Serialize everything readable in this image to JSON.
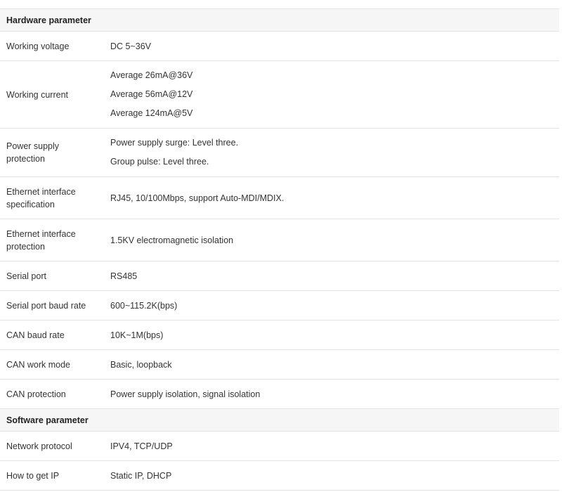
{
  "sections": [
    {
      "title": "Hardware parameter",
      "rows": [
        {
          "name": "Working voltage",
          "values": [
            "DC 5~36V"
          ]
        },
        {
          "name": "Working current",
          "values": [
            "Average 26mA@36V",
            "Average 56mA@12V",
            "Average 124mA@5V"
          ]
        },
        {
          "name": "Power supply protection",
          "values": [
            "Power supply surge: Level three.",
            "Group pulse: Level three."
          ]
        },
        {
          "name": "Ethernet interface specification",
          "values": [
            "RJ45, 10/100Mbps, support Auto-MDI/MDIX."
          ]
        },
        {
          "name": "Ethernet interface protection",
          "values": [
            "1.5KV electromagnetic isolation"
          ]
        },
        {
          "name": "Serial port",
          "values": [
            "RS485"
          ]
        },
        {
          "name": "Serial port baud rate",
          "values": [
            "600~115.2K(bps)"
          ]
        },
        {
          "name": "CAN baud rate",
          "values": [
            "10K~1M(bps)"
          ]
        },
        {
          "name": "CAN work mode",
          "values": [
            "Basic, loopback"
          ]
        },
        {
          "name": "CAN protection",
          "values": [
            "Power supply isolation, signal isolation"
          ]
        }
      ]
    },
    {
      "title": "Software parameter",
      "rows": [
        {
          "name": "Network protocol",
          "values": [
            "IPV4, TCP/UDP"
          ]
        },
        {
          "name": "How to get IP",
          "values": [
            "Static IP, DHCP"
          ]
        }
      ]
    }
  ]
}
